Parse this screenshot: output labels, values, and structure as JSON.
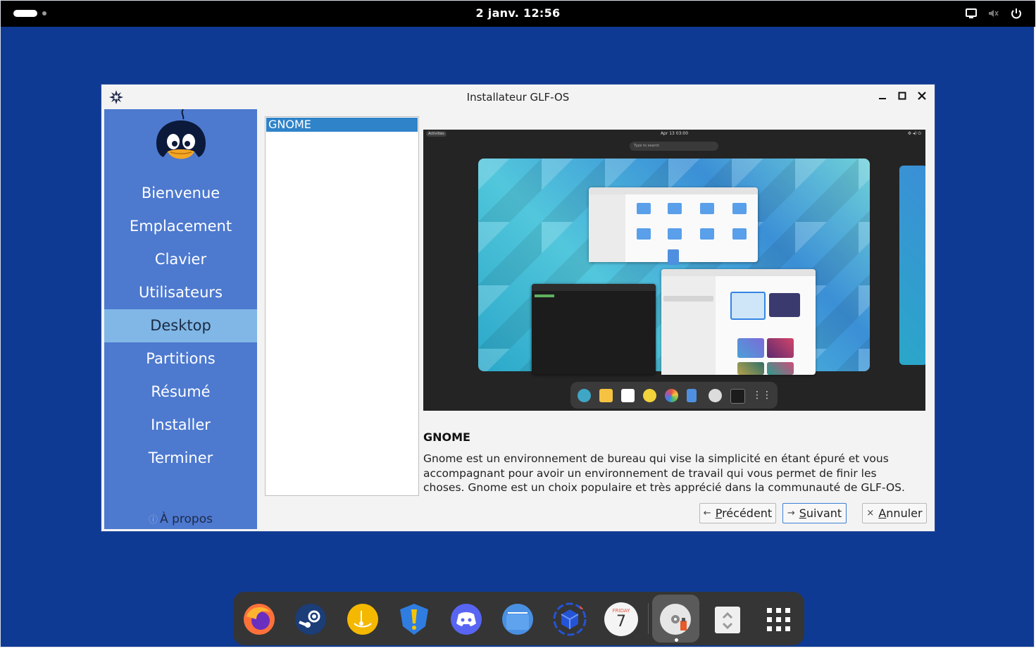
{
  "topbar": {
    "clock": "2 janv. 12:56"
  },
  "window": {
    "title": "Installateur GLF-OS"
  },
  "sidebar": {
    "items": [
      {
        "label": "Bienvenue"
      },
      {
        "label": "Emplacement"
      },
      {
        "label": "Clavier"
      },
      {
        "label": "Utilisateurs"
      },
      {
        "label": "Desktop",
        "active": true
      },
      {
        "label": "Partitions"
      },
      {
        "label": "Résumé"
      },
      {
        "label": "Installer"
      },
      {
        "label": "Terminer"
      }
    ],
    "about_icon": "ⓘ",
    "about_label": "À propos"
  },
  "desktop_list": {
    "items": [
      "GNOME"
    ],
    "selected": "GNOME"
  },
  "preview": {
    "activities": "Activities",
    "clock": "Apr 13 03:00",
    "search_placeholder": "Type to search"
  },
  "description": {
    "title": "GNOME",
    "body": "Gnome est un environnement de bureau qui vise la simplicité en étant épuré et vous accompagnant pour avoir un environnement de travail qui vous permet de finir les choses. Gnome est un choix populaire et très apprécié dans la communauté de GLF-OS."
  },
  "buttons": {
    "previous_glyph": "←",
    "previous_mnemonic": "P",
    "previous_rest": "récédent",
    "next_glyph": "→",
    "next_mnemonic": "S",
    "next_rest": "uivant",
    "cancel_glyph": "×",
    "cancel_mnemonic": "A",
    "cancel_rest": "nnuler"
  },
  "dock": {
    "apps": [
      {
        "icon": "firefox-icon",
        "color": "#ff7139"
      },
      {
        "icon": "steam-icon",
        "color": "#1b3d78"
      },
      {
        "icon": "lutris-icon",
        "color": "#f5b800"
      },
      {
        "icon": "heroic-icon",
        "color": "#2f7de1"
      },
      {
        "icon": "discord-icon",
        "color": "#5865f2"
      },
      {
        "icon": "files-icon",
        "color": "#4a90e2"
      },
      {
        "icon": "software-icon",
        "color": "#2454d6"
      },
      {
        "icon": "calendar-icon",
        "color": "#f4f4f4"
      },
      {
        "icon": "installer-disc-icon",
        "color": "#e6e6e6"
      },
      {
        "icon": "trash-icon",
        "color": "#efefef"
      },
      {
        "icon": "app-grid-icon",
        "color": "#ffffff"
      }
    ],
    "calendar_day": "FRIDAY",
    "calendar_date": "7"
  },
  "colors": {
    "desktop_bg": "#0f3a94",
    "sidebar_bg": "#4d79cf",
    "sidebar_active": "#80b7e6",
    "list_selected": "#2f83c9"
  }
}
